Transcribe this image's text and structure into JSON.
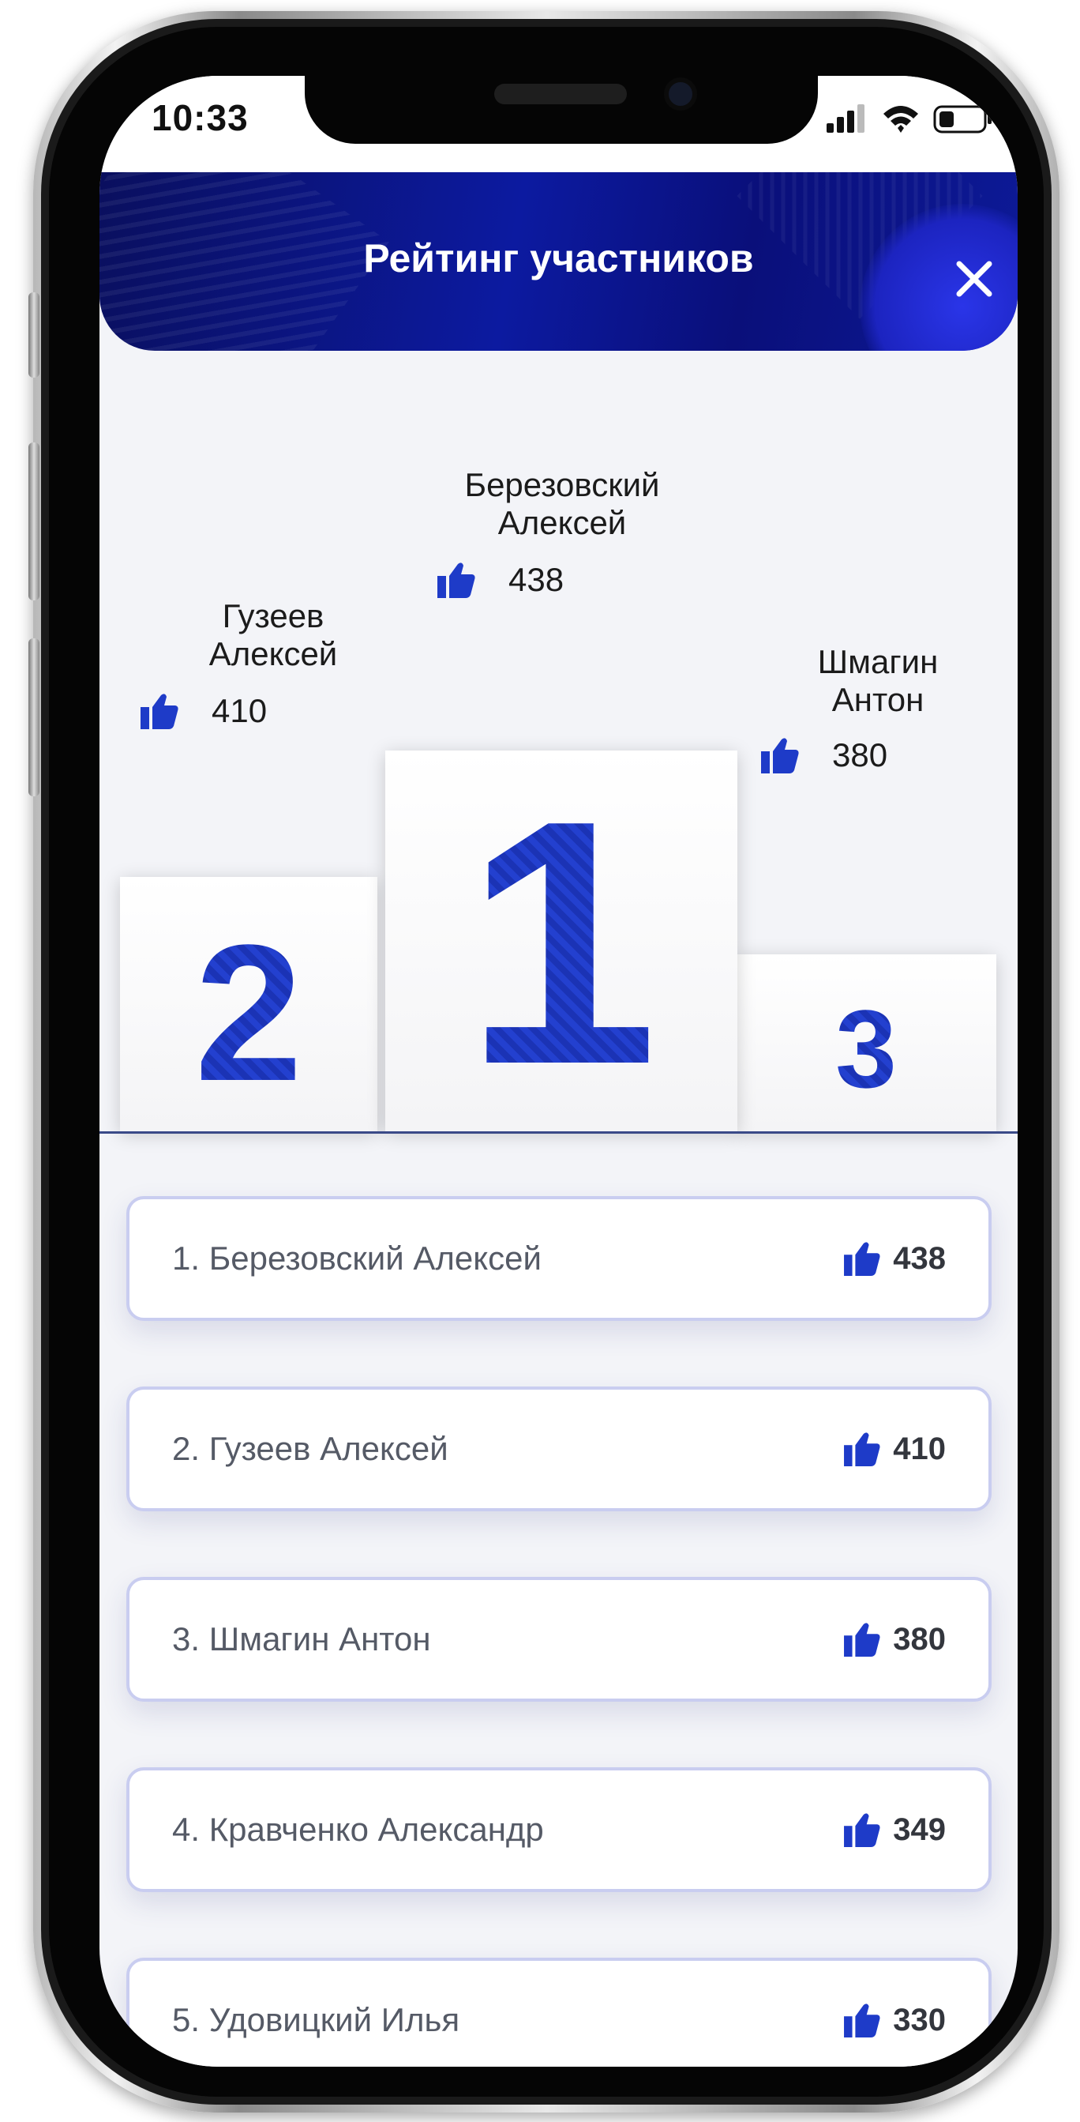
{
  "status_bar": {
    "time": "10:33"
  },
  "header": {
    "title": "Рейтинг участников",
    "close_icon": "close-icon"
  },
  "podium": {
    "first": {
      "place": "1",
      "name_line1": "Березовский",
      "name_line2": "Алексей",
      "likes": "438"
    },
    "second": {
      "place": "2",
      "name_line1": "Гузеев",
      "name_line2": "Алексей",
      "likes": "410"
    },
    "third": {
      "place": "3",
      "name_line1": "Шмагин",
      "name_line2": "Антон",
      "likes": "380"
    }
  },
  "leaderboard": [
    {
      "label": "1. Березовский Алексей",
      "score": "438"
    },
    {
      "label": "2. Гузеев Алексей",
      "score": "410"
    },
    {
      "label": "3. Шмагин Антон",
      "score": "380"
    },
    {
      "label": "4. Кравченко Александр",
      "score": "349"
    },
    {
      "label": "5. Удовицкий Илья",
      "score": "330"
    }
  ],
  "colors": {
    "accent": "#1e3bc8",
    "header_dark": "#0a0f5e",
    "card_border": "#c9cdf0"
  },
  "icons": {
    "like": "thumbs-up-icon"
  }
}
